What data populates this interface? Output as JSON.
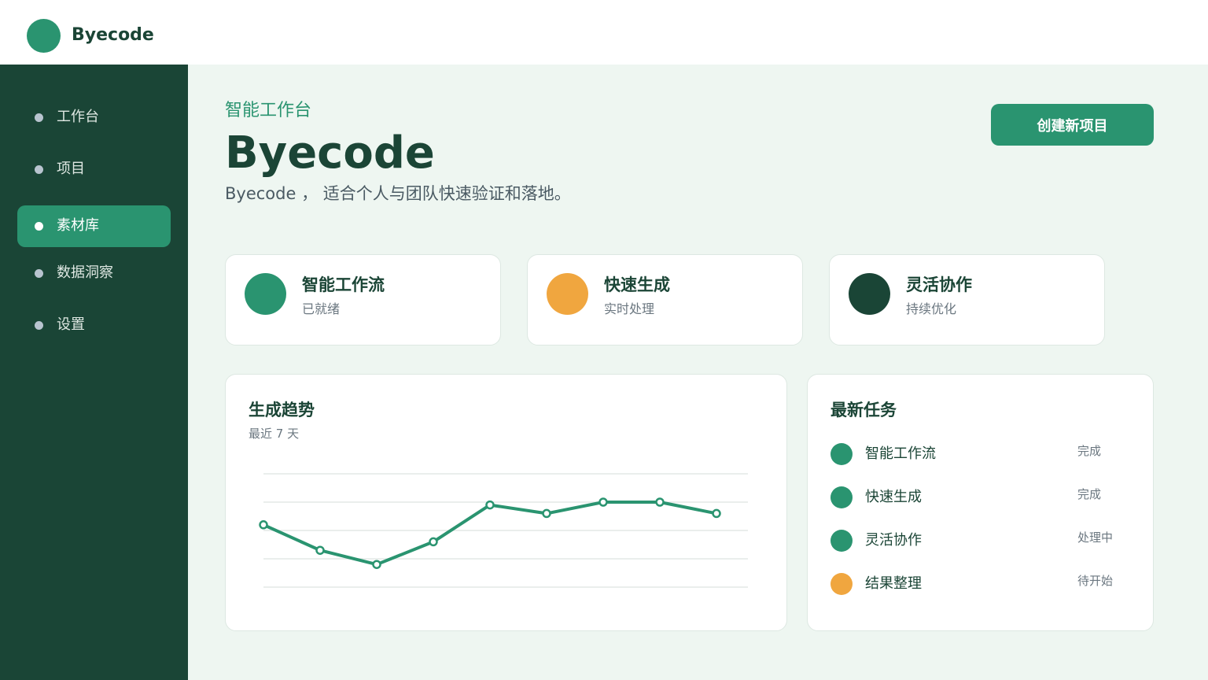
{
  "app": {
    "brand": "Byecode",
    "colors": {
      "primary": "#2a9470",
      "dark": "#1a4536",
      "accent": "#f0a63f",
      "background": "#eef6f1"
    }
  },
  "sidebar": {
    "items": [
      {
        "label": "工作台",
        "active": false
      },
      {
        "label": "项目",
        "active": false
      },
      {
        "label": "素材库",
        "active": true
      },
      {
        "label": "数据洞察",
        "active": false
      },
      {
        "label": "设置",
        "active": false
      }
    ]
  },
  "header": {
    "eyebrow": "智能工作台",
    "title": "Byecode",
    "subtitle": "Byecode ， 适合个人与团队快速验证和落地。",
    "create_label": "创建新项目"
  },
  "stats": [
    {
      "title": "智能工作流",
      "sub": "已就绪",
      "color": "#2a9470"
    },
    {
      "title": "快速生成",
      "sub": "实时处理",
      "color": "#f0a63f"
    },
    {
      "title": "灵活协作",
      "sub": "持续优化",
      "color": "#1a4536"
    }
  ],
  "trend": {
    "title": "生成趋势",
    "subtitle": "最近 7 天"
  },
  "chart_data": {
    "type": "line",
    "title": "生成趋势",
    "subtitle": "最近 7 天",
    "x": [
      1,
      2,
      3,
      4,
      5,
      6,
      7,
      8,
      9
    ],
    "values": [
      42,
      33,
      28,
      36,
      49,
      46,
      50,
      50,
      46
    ],
    "ylim": [
      20,
      60
    ],
    "grid": true,
    "color": "#2a9470"
  },
  "tasks": {
    "title": "最新任务",
    "items": [
      {
        "name": "智能工作流",
        "status": "完成",
        "color": "#2a9470"
      },
      {
        "name": "快速生成",
        "status": "完成",
        "color": "#2a9470"
      },
      {
        "name": "灵活协作",
        "status": "处理中",
        "color": "#2a9470"
      },
      {
        "name": "结果整理",
        "status": "待开始",
        "color": "#f0a63f"
      }
    ]
  }
}
